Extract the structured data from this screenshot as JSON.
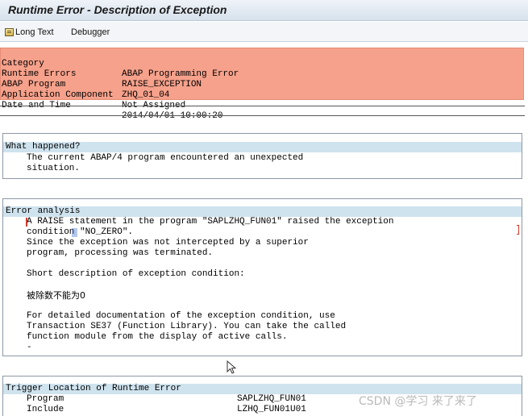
{
  "window": {
    "title": "Runtime Error - Description of Exception"
  },
  "toolbar": {
    "long_text_label": "Long Text",
    "debugger_label": "Debugger"
  },
  "header": {
    "rows": [
      {
        "key": "Category",
        "value": "ABAP Programming Error"
      },
      {
        "key": "Runtime Errors",
        "value": "RAISE_EXCEPTION"
      },
      {
        "key": "ABAP Program",
        "value": "ZHQ_01_04"
      },
      {
        "key": "Application Component",
        "value": "Not Assigned"
      },
      {
        "key": "Date and Time",
        "value": "2014/04/01 10:00:20"
      }
    ],
    "highlight_color": "#f6a18b"
  },
  "what_happened": {
    "title": "What happened?",
    "lines": [
      "The current ABAP/4 program encountered an unexpected",
      "situation."
    ]
  },
  "error_analysis": {
    "title": "Error analysis",
    "lines": [
      "A RAISE statement in the program \"SAPLZHQ_FUN01\" raised the exception",
      "condition \"NO_ZERO\".",
      "Since the exception was not intercepted by a superior",
      "program, processing was terminated.",
      "",
      "Short description of exception condition:",
      "",
      "被除数不能为0",
      "",
      "For detailed documentation of the exception condition, use",
      "Transaction SE37 (Function Library). You can take the called",
      "function module from the display of active calls.",
      "-"
    ]
  },
  "trigger_location": {
    "title": "Trigger Location of Runtime Error",
    "rows": [
      {
        "key": "Program",
        "value": "SAPLZHQ_FUN01"
      },
      {
        "key": "Include",
        "value": "LZHQ_FUN01U01"
      }
    ]
  },
  "watermark": "CSDN @学习 来了来了",
  "section_header_color": "#cfe3ee"
}
